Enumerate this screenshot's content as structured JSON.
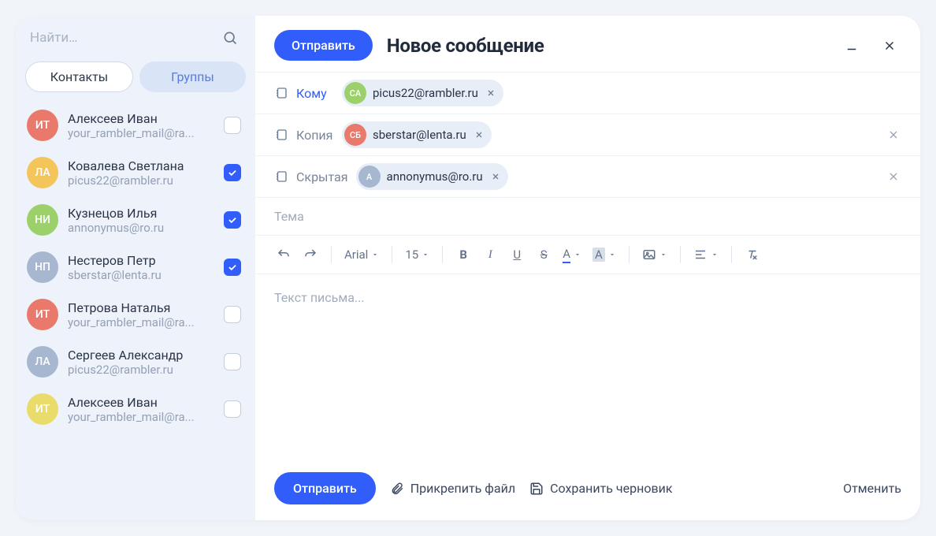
{
  "sidebar": {
    "search_placeholder": "Найти…",
    "tabs": {
      "contacts": "Контакты",
      "groups": "Группы"
    },
    "contacts": [
      {
        "initials": "ИТ",
        "color": "#e8796b",
        "name": "Алексеев Иван",
        "email": "your_rambler_mail@ra...",
        "checked": false
      },
      {
        "initials": "ЛА",
        "color": "#f3c55b",
        "name": "Ковалева Светлана",
        "email": "picus22@rambler.ru",
        "checked": true
      },
      {
        "initials": "НИ",
        "color": "#9bd06b",
        "name": "Кузнецов Илья",
        "email": "annonymus@ro.ru",
        "checked": true
      },
      {
        "initials": "НП",
        "color": "#a6b7cf",
        "name": "Нестеров Петр",
        "email": "sberstar@lenta.ru",
        "checked": true
      },
      {
        "initials": "ИТ",
        "color": "#e8796b",
        "name": "Петрова Наталья",
        "email": "your_rambler_mail@ra...",
        "checked": false
      },
      {
        "initials": "ЛА",
        "color": "#a6b7cf",
        "name": "Сергеев Александр",
        "email": "picus22@rambler.ru",
        "checked": false
      },
      {
        "initials": "ИТ",
        "color": "#e9dc6a",
        "name": "Алексеев Иван",
        "email": "your_rambler_mail@ra...",
        "checked": false
      }
    ]
  },
  "compose": {
    "send": "Отправить",
    "title": "Новое сообщение",
    "to_label": "Кому",
    "cc_label": "Копия",
    "bcc_label": "Скрытая",
    "to_chip": {
      "initials": "СА",
      "color": "#9bd06b",
      "email": "picus22@rambler.ru"
    },
    "cc_chip": {
      "initials": "СБ",
      "color": "#e8796b",
      "email": "sberstar@lenta.ru"
    },
    "bcc_chip": {
      "initials": "А",
      "color": "#a6b7cf",
      "email": "annonymus@ro.ru"
    },
    "subject_placeholder": "Тема",
    "body_placeholder": "Текст письма...",
    "toolbar": {
      "font": "Arial",
      "size": "15"
    },
    "footer": {
      "send": "Отправить",
      "attach": "Прикрепить файл",
      "draft": "Сохранить черновик",
      "cancel": "Отменить"
    }
  }
}
